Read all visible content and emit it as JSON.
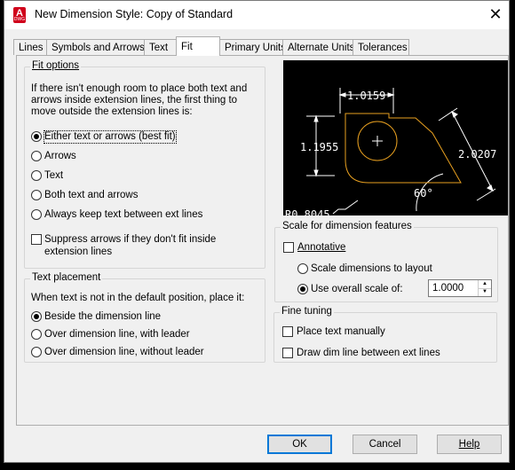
{
  "window": {
    "title": "New Dimension Style: Copy of Standard",
    "close": "✕",
    "icon_label": "A",
    "icon_sublabel": "DWG"
  },
  "tabs": [
    "Lines",
    "Symbols and Arrows",
    "Text",
    "Fit",
    "Primary Units",
    "Alternate Units",
    "Tolerances"
  ],
  "active_tab": "Fit",
  "fit_options": {
    "legend": "Fit options",
    "description": [
      "If there isn't enough room to place both text and",
      "arrows inside extension lines, the first thing to",
      "move outside the extension lines is:"
    ],
    "radios": [
      "Either text or arrows (best fit)",
      "Arrows",
      "Text",
      "Both text and arrows",
      "Always keep text between ext lines"
    ],
    "selected": 0,
    "suppress": [
      "Suppress arrows if they don't fit inside",
      "extension lines"
    ]
  },
  "text_placement": {
    "legend": "Text placement",
    "description": "When text is not in the default position, place it:",
    "radios": [
      "Beside the dimension line",
      "Over dimension line, with leader",
      "Over dimension line, without leader"
    ],
    "selected": 0
  },
  "preview": {
    "top_dim": "1.0159",
    "left_dim": "1.1955",
    "right_dim": "2.0207",
    "angle": "60°",
    "radius": "R0.8045",
    "line_color": "#e8a020"
  },
  "scale": {
    "legend": "Scale for dimension features",
    "annotative": "Annotative",
    "layout": "Scale dimensions to layout",
    "overall": "Use overall scale of:",
    "overall_value": "1.0000",
    "selected": 1
  },
  "fine_tuning": {
    "legend": "Fine tuning",
    "place_manually": "Place text manually",
    "draw_dim_line": "Draw dim line between ext lines"
  },
  "buttons": {
    "ok": "OK",
    "cancel": "Cancel",
    "help": "Help"
  }
}
